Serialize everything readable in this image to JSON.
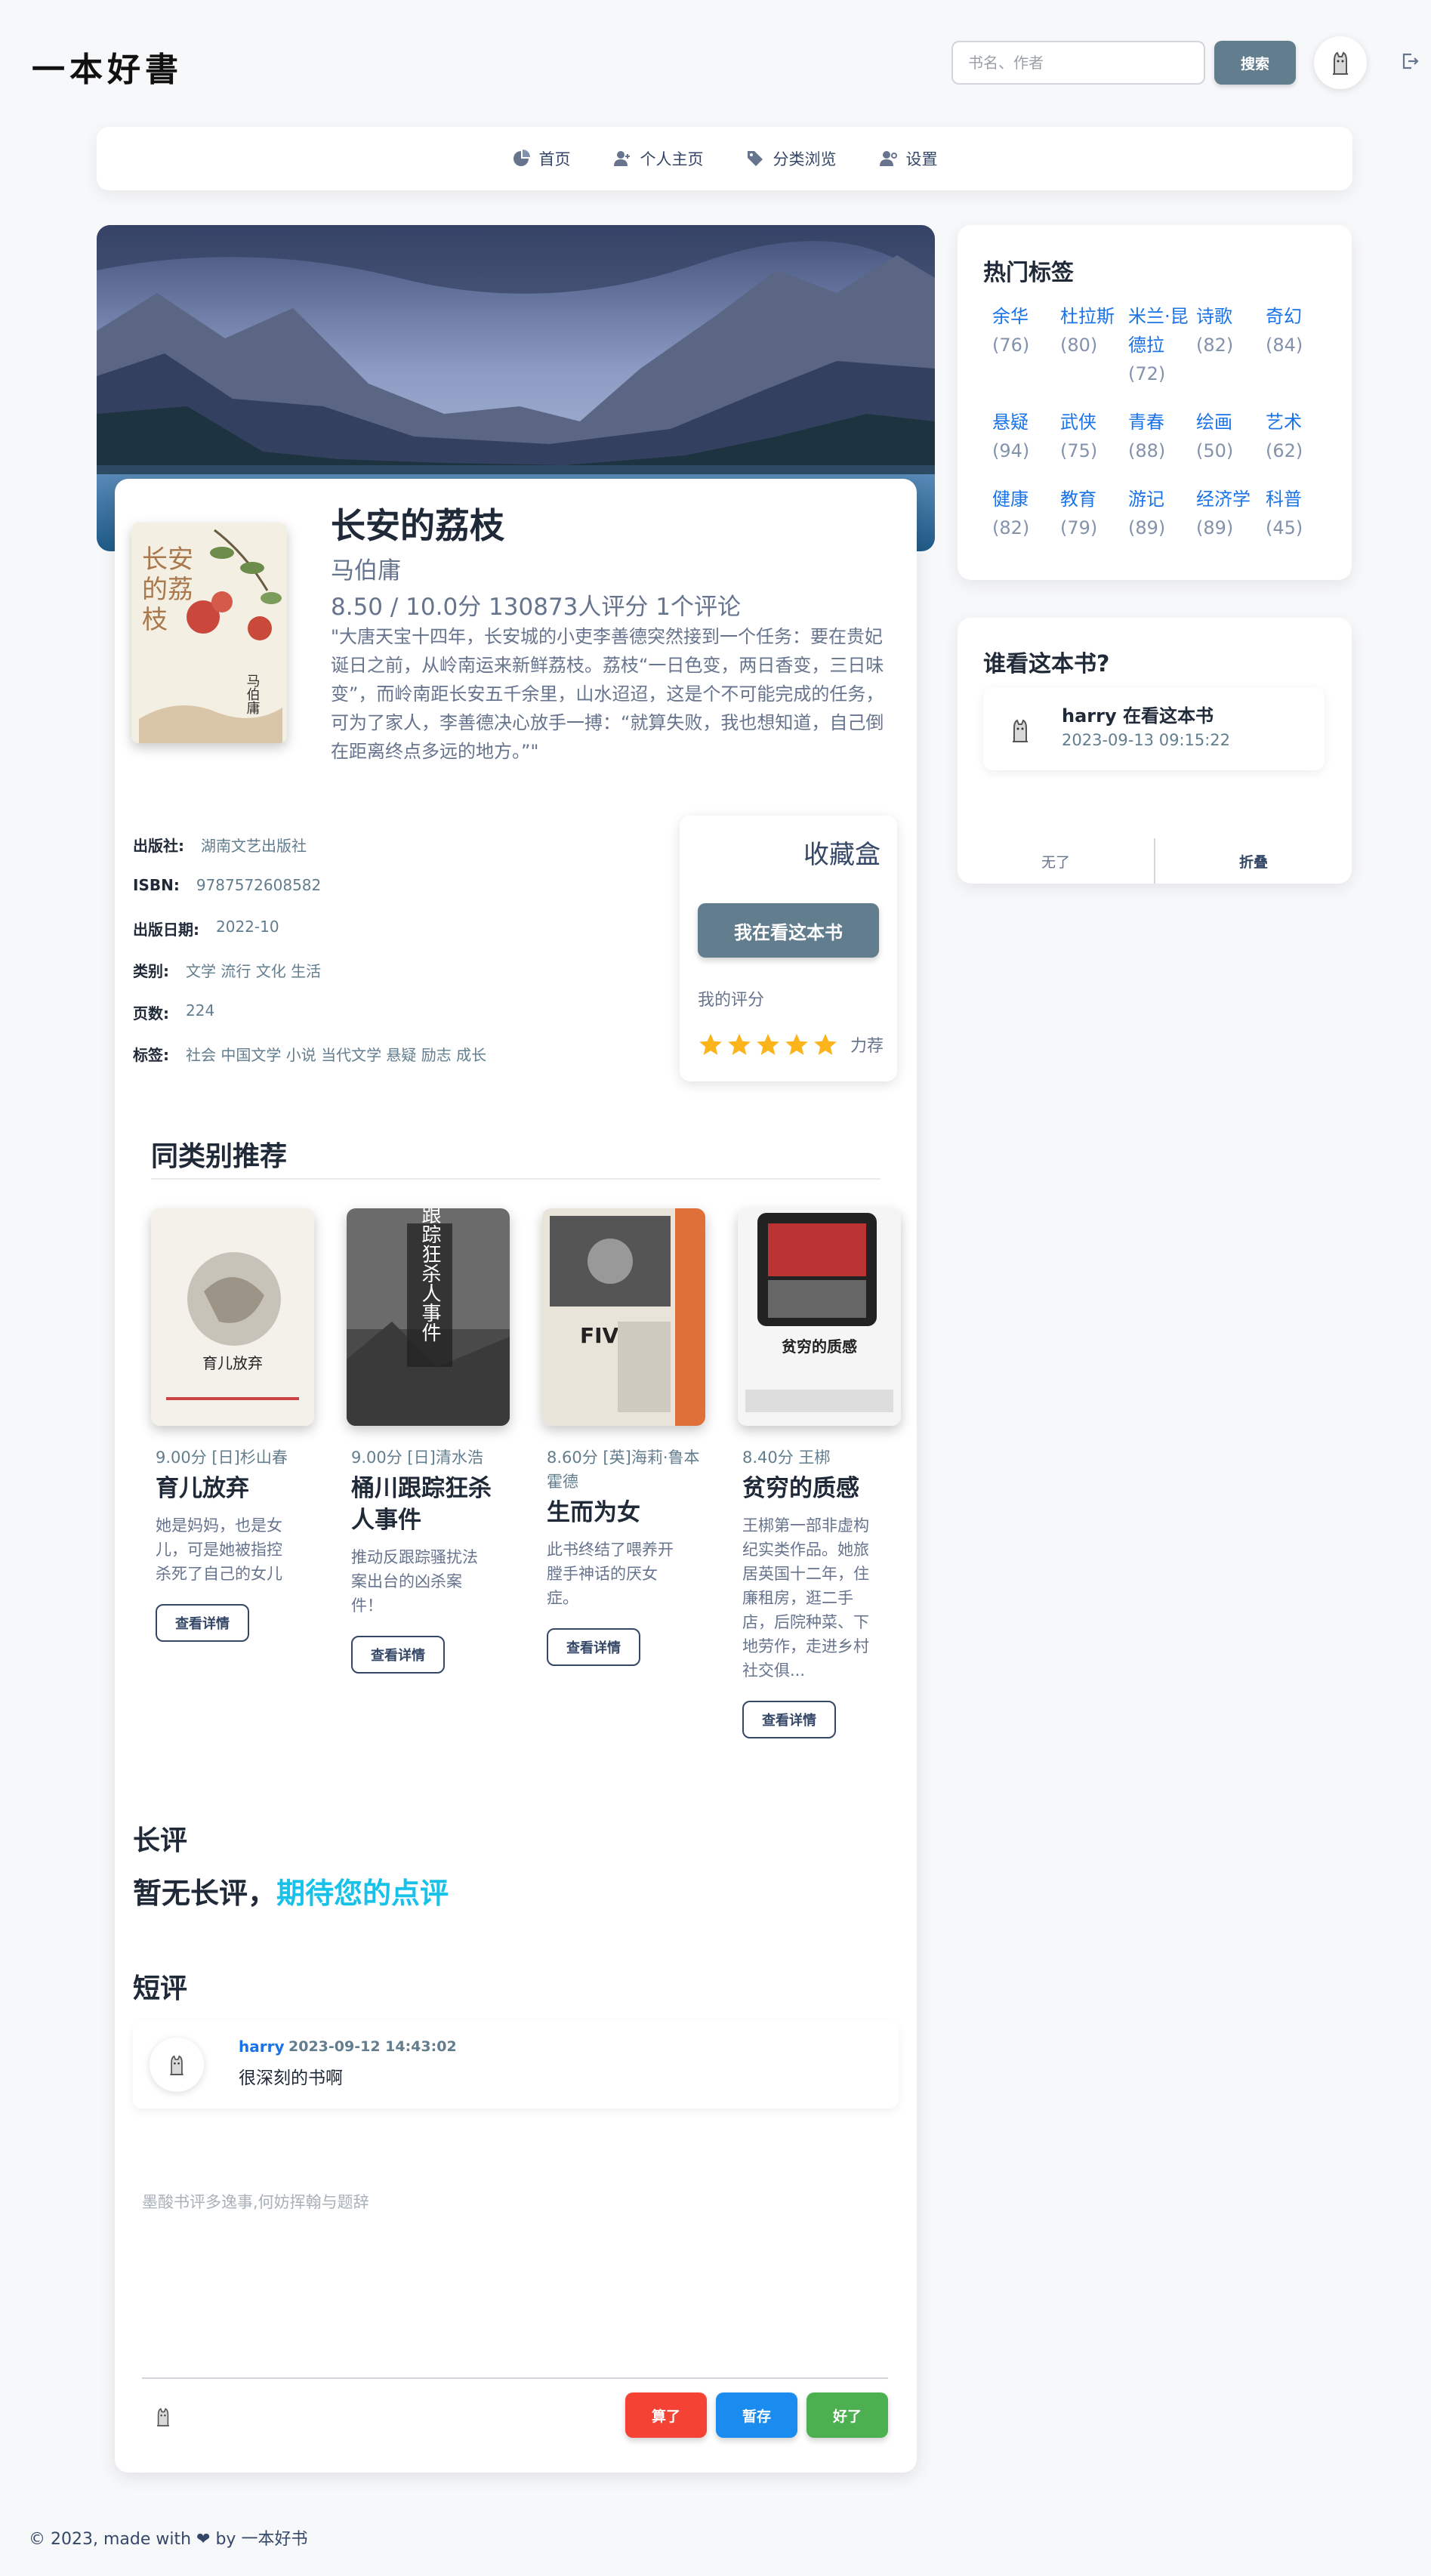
{
  "header": {
    "logo": "一本好書",
    "search_placeholder": "书名、作者",
    "search_button": "搜索"
  },
  "nav": {
    "items": [
      {
        "label": "首页",
        "icon": "home-icon"
      },
      {
        "label": "个人主页",
        "icon": "user-icon"
      },
      {
        "label": "分类浏览",
        "icon": "tag-icon"
      },
      {
        "label": "设置",
        "icon": "user-settings-icon"
      }
    ]
  },
  "book": {
    "title": "长安的荔枝",
    "author": "马伯庸",
    "rating_line": "8.50 / 10.0分 130873人评分 1个评论",
    "description": "\"大唐天宝十四年，长安城的小吏李善德突然接到一个任务：要在贵妃诞日之前，从岭南运来新鲜荔枝。荔枝“一日色变，两日香变，三日味变”，而岭南距长安五千余里，山水迢迢，这是个不可能完成的任务，可为了家人，李善德决心放手一搏：“就算失败，我也想知道，自己倒在距离终点多远的地方。”\"",
    "cover_text": "长安的荔枝",
    "cover_author": "马伯庸",
    "info": [
      {
        "label": "出版社:",
        "value": "湖南文艺出版社"
      },
      {
        "label": "ISBN:",
        "value": "9787572608582"
      },
      {
        "label": "出版日期:",
        "value": "2022-10"
      },
      {
        "label": "类别:",
        "value": "文学 流行 文化 生活"
      },
      {
        "label": "页数:",
        "value": "224"
      },
      {
        "label": "标签:",
        "value": "社会 中国文学 小说 当代文学 悬疑 励志 成长"
      }
    ]
  },
  "collection": {
    "title": "收藏盒",
    "reading_button": "我在看这本书",
    "my_rating_label": "我的评分",
    "stars": 5,
    "star_text": "力荐"
  },
  "similar": {
    "title": "同类别推荐",
    "items": [
      {
        "meta": "9.00分 [日]杉山春",
        "title": "育儿放弃",
        "desc": "她是妈妈，也是女儿，可是她被指控杀死了自己的女儿",
        "button": "查看详情",
        "cover_color": "#f4f1ea",
        "cover_text": "育儿放弃"
      },
      {
        "meta": "9.00分 [日]清水浩",
        "title": "桶川跟踪狂杀人事件",
        "desc": "推动反跟踪骚扰法案出台的凶杀案件！",
        "button": "查看详情",
        "cover_color": "#6b6b6b",
        "cover_text": "桶川跟踪狂杀人事件"
      },
      {
        "meta": "8.60分 [英]海莉·鲁本霍德",
        "title": "生而为女",
        "desc": "此书终结了喂养开膛手神话的厌女症。",
        "button": "查看详情",
        "cover_color": "#e8e4da",
        "cover_text": "FIVE"
      },
      {
        "meta": "8.40分 王梆",
        "title": "贫穷的质感",
        "desc": "王梆第一部非虚构纪实类作品。她旅居英国十二年，住廉租房，逛二手店，后院种菜、下地劳作，走进乡村社交俱...",
        "button": "查看详情",
        "cover_color": "#f5f5f5",
        "cover_text": "贫穷的质感"
      }
    ]
  },
  "long_review": {
    "title": "长评",
    "empty_text": "暂无长评，",
    "empty_highlight": "期待您的点评"
  },
  "short_review": {
    "title": "短评",
    "comments": [
      {
        "user": "harry",
        "time": "2023-09-12 14:43:02",
        "text": "很深刻的书啊"
      }
    ]
  },
  "editor": {
    "placeholder": "墨酸书评多逸事,何妨挥翰与题辞",
    "buttons": [
      {
        "label": "算了",
        "color": "#f44335"
      },
      {
        "label": "暂存",
        "color": "#1a8cf0"
      },
      {
        "label": "好了",
        "color": "#4caf50"
      }
    ]
  },
  "sidebar": {
    "tags_title": "热门标签",
    "tags": [
      {
        "name": "余华",
        "count": "(76)"
      },
      {
        "name": "杜拉斯",
        "count": "(80)"
      },
      {
        "name": "米兰·昆德拉",
        "count": "(72)"
      },
      {
        "name": "诗歌",
        "count": "(82)"
      },
      {
        "name": "奇幻",
        "count": "(84)"
      },
      {
        "name": "悬疑",
        "count": "(94)"
      },
      {
        "name": "武侠",
        "count": "(75)"
      },
      {
        "name": "青春",
        "count": "(88)"
      },
      {
        "name": "绘画",
        "count": "(50)"
      },
      {
        "name": "艺术",
        "count": "(62)"
      },
      {
        "name": "健康",
        "count": "(82)"
      },
      {
        "name": "教育",
        "count": "(79)"
      },
      {
        "name": "游记",
        "count": "(89)"
      },
      {
        "name": "经济学",
        "count": "(89)"
      },
      {
        "name": "科普",
        "count": "(45)"
      }
    ],
    "who_title": "谁看这本书?",
    "who_items": [
      {
        "text": "harry 在看这本书",
        "time": "2023-09-13 09:15:22"
      }
    ],
    "who_footer": [
      "无了",
      "折叠"
    ]
  },
  "footer": {
    "text": "© 2023, made with ❤ by 一本好书"
  }
}
